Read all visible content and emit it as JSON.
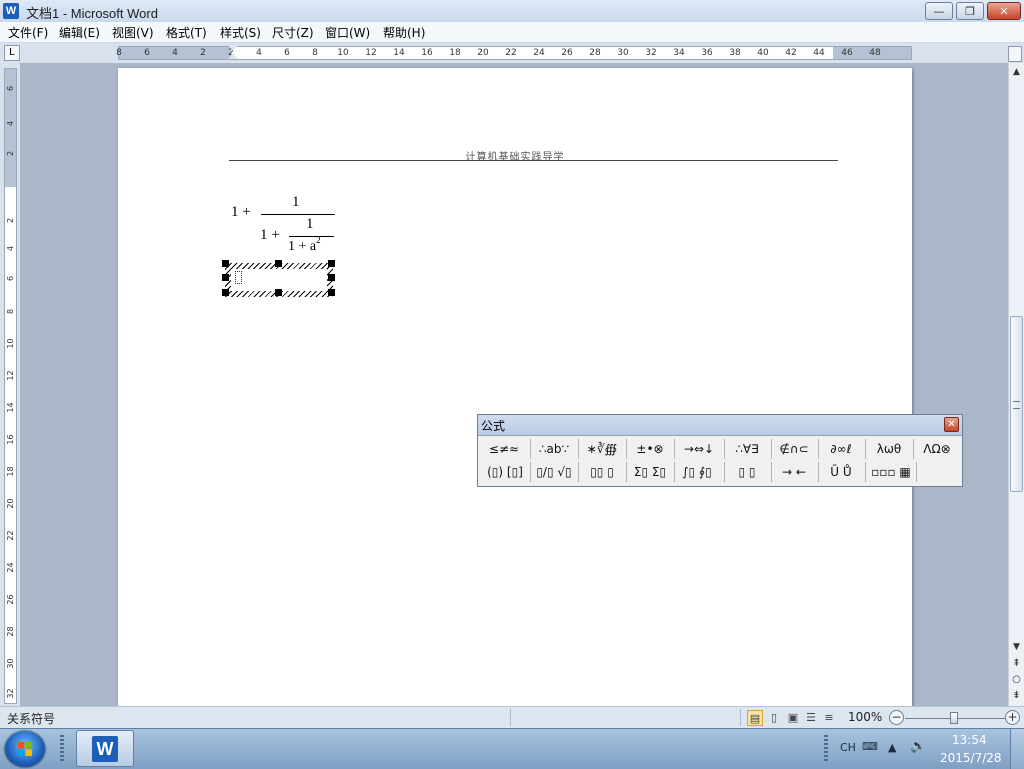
{
  "window": {
    "app_icon": "W",
    "title": "文档1 - Microsoft Word",
    "minimize": "—",
    "maximize": "❐",
    "close": "✕"
  },
  "menu": [
    {
      "label": "文件(F)"
    },
    {
      "label": "编辑(E)"
    },
    {
      "label": "视图(V)"
    },
    {
      "label": "格式(T)"
    },
    {
      "label": "样式(S)"
    },
    {
      "label": "尺寸(Z)"
    },
    {
      "label": "窗口(W)"
    },
    {
      "label": "帮助(H)"
    }
  ],
  "ruler": {
    "tab_selector": "L",
    "horizontal_labels": [
      "8",
      "6",
      "4",
      "2",
      "2",
      "4",
      "6",
      "8",
      "10",
      "12",
      "14",
      "16",
      "18",
      "20",
      "22",
      "24",
      "26",
      "28",
      "30",
      "32",
      "34",
      "36",
      "38",
      "40",
      "42",
      "44",
      "46",
      "48"
    ],
    "vertical_labels": [
      "6",
      "4",
      "2",
      "2",
      "4",
      "6",
      "8",
      "10",
      "12",
      "14",
      "16",
      "18",
      "20",
      "22",
      "24",
      "26",
      "28",
      "30",
      "32"
    ]
  },
  "document": {
    "header_text": "计算机基础实践导学",
    "equation": {
      "lead": "1 +",
      "numerator": "1",
      "inner_lead": "1 +",
      "inner_numerator": "1",
      "inner_denominator_base": "1 + a",
      "inner_denominator_exp": "2"
    }
  },
  "formula_toolbar": {
    "title": "公式",
    "close": "✕",
    "row1": [
      "≤≠≈",
      "∴ab∵",
      "∗∛∰",
      "±•⊗",
      "→⇔↓",
      "∴∀∃",
      "∉∩⊂",
      "∂∞ℓ",
      "λωθ",
      "ΛΩ⊗"
    ],
    "row2": [
      "(▯) [▯]",
      "▯/▯ √▯",
      "▯▯ ▯",
      "Σ▯ Σ▯",
      "∫▯ ∮▯",
      "▯ ▯",
      "→ ←",
      "Ū Ů",
      "▫▫▫ ▦"
    ]
  },
  "statusbar": {
    "status": "关系符号",
    "zoom": "100%",
    "zoom_level_percent": 100,
    "view_icons": [
      "page-layout-view-icon",
      "reading-view-icon",
      "web-view-icon",
      "outline-view-icon",
      "draft-view-icon"
    ]
  },
  "taskbar": {
    "word_icon": "W",
    "ime": "CH",
    "time": "13:54",
    "date": "2015/7/28"
  },
  "colors": {
    "titlebar": "#dfe9f5",
    "workspace": "#a9b7c9",
    "close_red": "#c6442a",
    "word_blue": "#1d5fb8"
  }
}
